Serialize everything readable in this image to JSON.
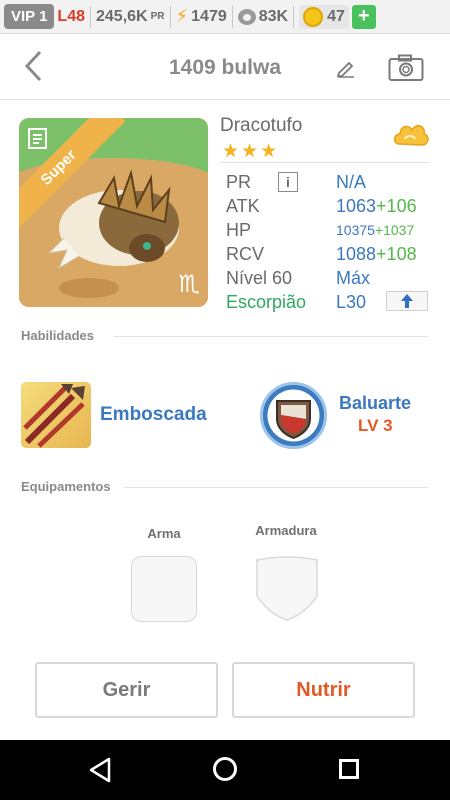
{
  "topbar": {
    "vip": "VIP 1",
    "level": "L48",
    "power": "245,6K",
    "power_unit": "PR",
    "energy": "1479",
    "food": "83K",
    "gems": "47",
    "add_symbol": "+"
  },
  "header": {
    "title": "1409 bulwa"
  },
  "creature": {
    "name": "Dracotufo",
    "rarity_badge": "Super",
    "stars": "★★★",
    "stats": {
      "pr_label": "PR",
      "info_symbol": "i",
      "pr_value": "N/A",
      "atk_label": "ATK",
      "atk_value": "1063",
      "atk_bonus": "+106",
      "hp_label": "HP",
      "hp_value": "10375",
      "hp_bonus": "+1037",
      "rcv_label": "RCV",
      "rcv_value": "1088",
      "rcv_bonus": "+108",
      "level_label": "Nível 60",
      "level_value": "Máx",
      "sign_label": "Escorpião",
      "sign_level": "L30"
    },
    "zodiac_symbol": "♏"
  },
  "skills": {
    "section_title": "Habilidades",
    "active": {
      "name": "Emboscada"
    },
    "leader": {
      "name": "Baluarte",
      "level": "LV 3"
    }
  },
  "equipment": {
    "section_title": "Equipamentos",
    "weapon_label": "Arma",
    "armor_label": "Armadura"
  },
  "actions": {
    "manage": "Gerir",
    "feed": "Nutrir"
  },
  "colors": {
    "accent_blue": "#3b78c0",
    "bonus_green": "#52b948",
    "sign_green": "#2fa860",
    "highlight_orange": "#e25a26",
    "level_red": "#e03a22"
  },
  "icons": {
    "energy": "lightning-icon",
    "food": "paw-icon",
    "gems": "coin-icon",
    "edit": "pencil-icon",
    "photo": "camera-icon",
    "rank": "cloud-rank-icon",
    "upgrade": "arrow-up-icon"
  }
}
